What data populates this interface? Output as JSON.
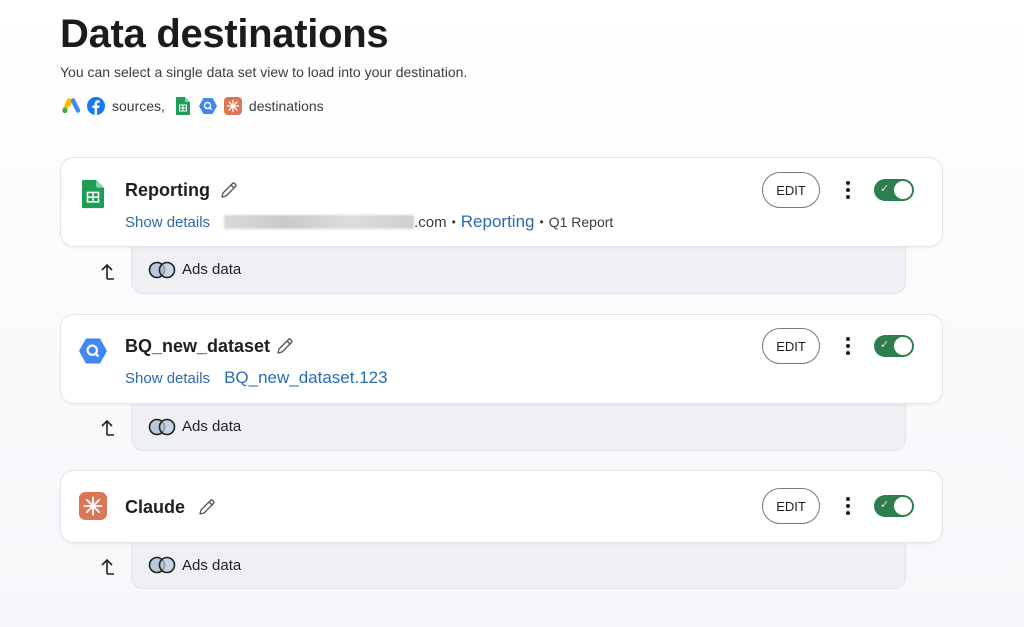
{
  "page": {
    "title": "Data destinations",
    "subtitle": "You can select a single data set view to load into your destination.",
    "legend": {
      "sources_label": "sources,",
      "destinations_label": "destinations",
      "source_icons": [
        "google-ads-icon",
        "facebook-icon"
      ],
      "destination_icons": [
        "google-sheets-icon",
        "bigquery-icon",
        "claude-icon"
      ]
    }
  },
  "destinations": [
    {
      "name": "Reporting",
      "icon": "google-sheets-icon",
      "show_details": "Show details",
      "account_suffix": ".com",
      "separator": "•",
      "sheet_name": "Reporting",
      "tab_name": "Q1 Report",
      "edit_label": "EDIT",
      "enabled": true,
      "source_label": "Ads data"
    },
    {
      "name": "BQ_new_dataset",
      "icon": "bigquery-icon",
      "show_details": "Show details",
      "dataset_ref": "BQ_new_dataset.123",
      "edit_label": "EDIT",
      "enabled": true,
      "source_label": "Ads data"
    },
    {
      "name": "Claude",
      "icon": "claude-icon",
      "edit_label": "EDIT",
      "enabled": true,
      "source_label": "Ads data"
    }
  ],
  "colors": {
    "toggle_on": "#2e7d4f",
    "link": "#2a6bb0",
    "sheets_green": "#1e9e55",
    "bigquery_blue": "#4285f4",
    "claude_orange": "#d97757"
  }
}
